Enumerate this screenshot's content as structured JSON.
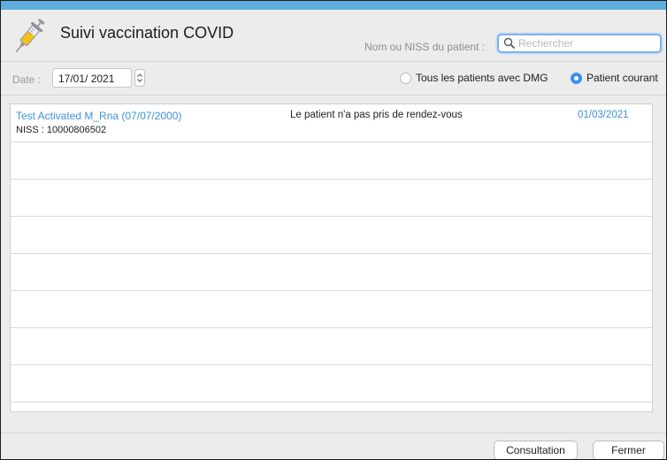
{
  "window": {
    "title": "Suivi vaccination COVID",
    "app_icon": "syringe-icon",
    "accent_color": "#5eaede"
  },
  "search": {
    "label": "Nom ou NISS du patient :",
    "placeholder": "Rechercher",
    "value": "",
    "icon": "magnifier-icon"
  },
  "filters": {
    "date_label": "Date :",
    "date_value": "17/01/ 2021",
    "radio_all_label": "Tous les patients avec DMG",
    "radio_current_label": "Patient courant",
    "selected": "Patient courant"
  },
  "patients": [
    {
      "name": "Test Activated M_Rna (07/07/2000)",
      "niss": "NISS : 10000806502",
      "status": "Le patient n'a pas pris de rendez-vous",
      "date": "01/03/2021"
    }
  ],
  "buttons": {
    "consultation": "Consultation",
    "close": "Fermer"
  }
}
